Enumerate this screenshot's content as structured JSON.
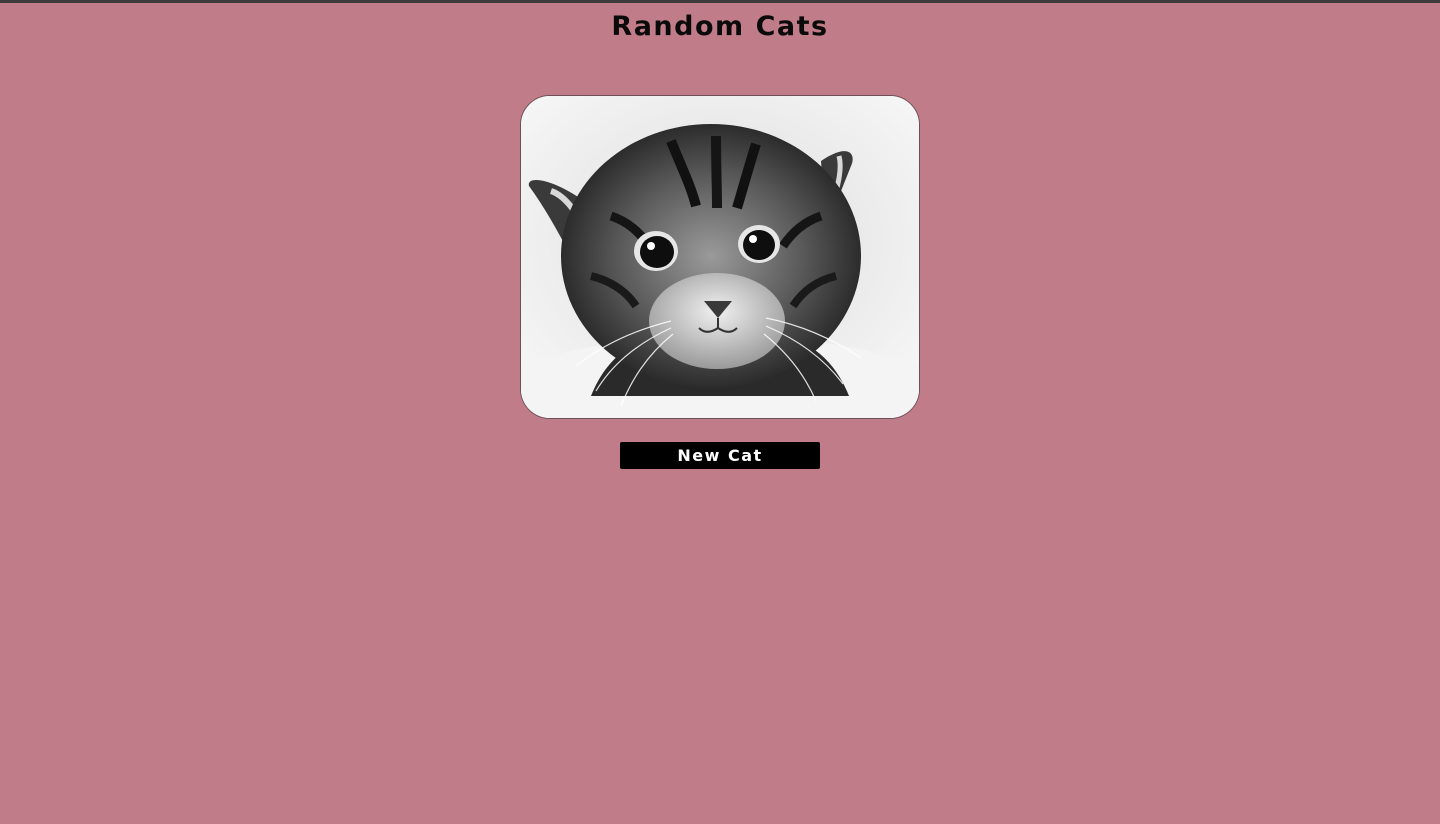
{
  "page": {
    "title": "Random Cats",
    "background_color": "#c07d89"
  },
  "cat_image": {
    "subject": "grayscale kitten photo",
    "alt": "Random cat"
  },
  "controls": {
    "new_cat_label": "New Cat"
  }
}
